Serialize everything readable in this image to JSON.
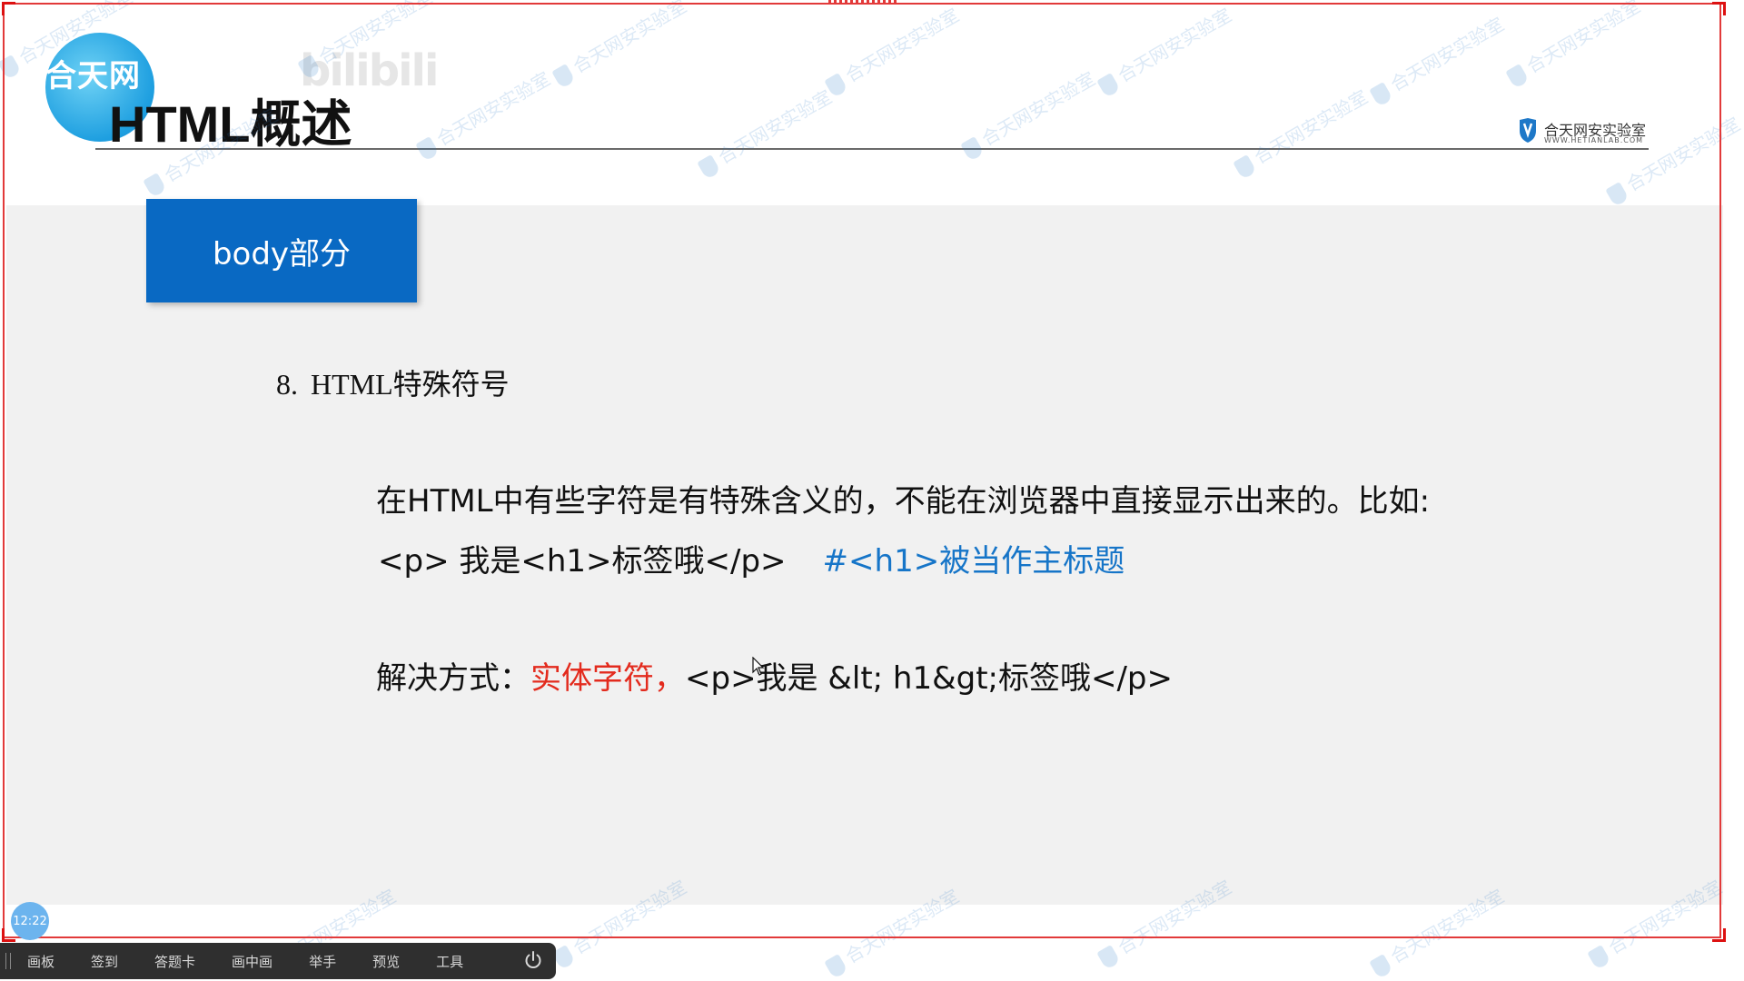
{
  "header": {
    "logo_text": "合天网",
    "faded_brand": "bilibili",
    "title": "HTML概述",
    "brand_name": "合天网安实验室",
    "brand_url": "WWW.HETIANLAB.COM"
  },
  "section": {
    "label": "body部分"
  },
  "content": {
    "heading_number": "8.",
    "heading_text": "HTML特殊符号",
    "line1": "在HTML中有些字符是有特殊含义的，不能在浏览器中直接显示出来的。比如:",
    "line2_code": "<p> 我是<h1>标签哦</p>",
    "line2_comment": "#<h1>被当作主标题",
    "line3_prefix": "解决方式：",
    "line3_highlight": "实体字符，",
    "line3_code": "<p>我是 &lt; h1&gt;标签哦</p>"
  },
  "watermark": {
    "text": "合天网安实验室"
  },
  "status": {
    "time": "12:22"
  },
  "toolbar": {
    "items": [
      "画板",
      "签到",
      "答题卡",
      "画中画",
      "举手",
      "预览",
      "工具"
    ]
  },
  "colors": {
    "section_bg": "#0969c3",
    "comment_blue": "#1675c8",
    "highlight_red": "#e32b1e",
    "frame_red": "#e23a3a"
  }
}
